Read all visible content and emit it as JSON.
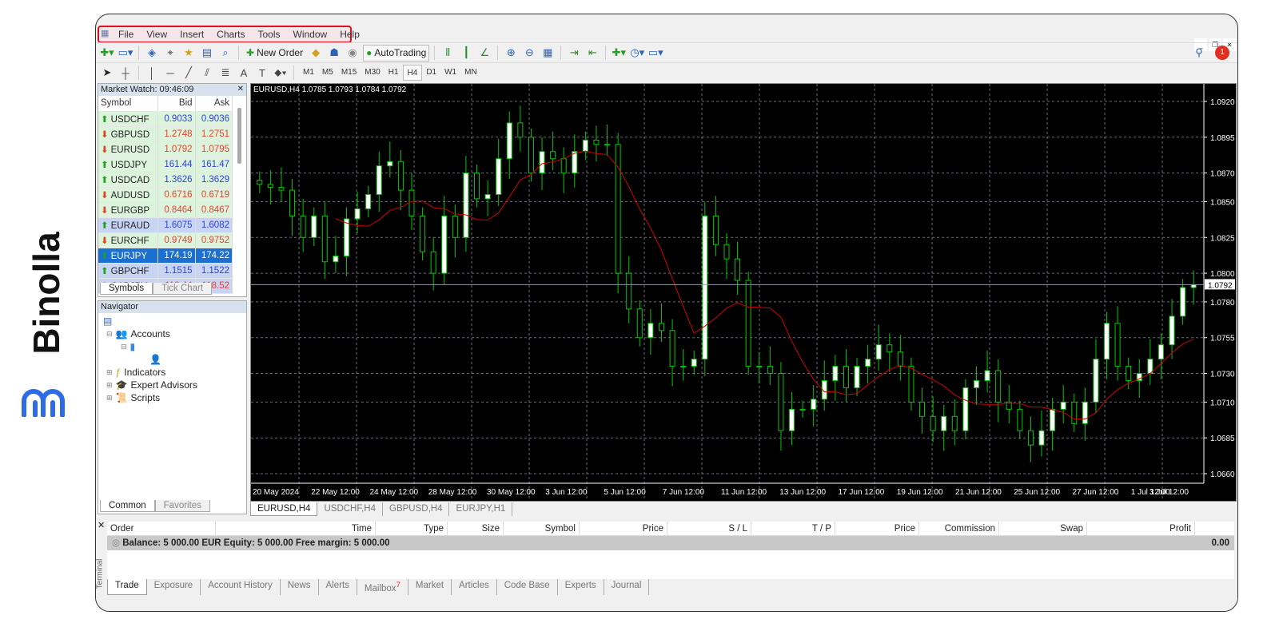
{
  "brand": {
    "name": "Binolla"
  },
  "menu": [
    "File",
    "View",
    "Insert",
    "Charts",
    "Tools",
    "Window",
    "Help"
  ],
  "toolbar": {
    "new_order": "New Order",
    "autotrading": "AutoTrading",
    "notification_count": "1"
  },
  "timeframes": [
    "M1",
    "M5",
    "M15",
    "M30",
    "H1",
    "H4",
    "D1",
    "W1",
    "MN"
  ],
  "active_timeframe": "H4",
  "market_watch": {
    "title": "Market Watch: 09:46:09",
    "columns": [
      "Symbol",
      "Bid",
      "Ask"
    ],
    "rows": [
      {
        "symbol": "USDCHF",
        "bid": "0.9033",
        "ask": "0.9036",
        "dir": "up"
      },
      {
        "symbol": "GBPUSD",
        "bid": "1.2748",
        "ask": "1.2751",
        "dir": "dn"
      },
      {
        "symbol": "EURUSD",
        "bid": "1.0792",
        "ask": "1.0795",
        "dir": "dn"
      },
      {
        "symbol": "USDJPY",
        "bid": "161.44",
        "ask": "161.47",
        "dir": "up"
      },
      {
        "symbol": "USDCAD",
        "bid": "1.3626",
        "ask": "1.3629",
        "dir": "up"
      },
      {
        "symbol": "AUDUSD",
        "bid": "0.6716",
        "ask": "0.6719",
        "dir": "dn"
      },
      {
        "symbol": "EURGBP",
        "bid": "0.8464",
        "ask": "0.8467",
        "dir": "dn"
      },
      {
        "symbol": "EURAUD",
        "bid": "1.6075",
        "ask": "1.6082",
        "dir": "up"
      },
      {
        "symbol": "EURCHF",
        "bid": "0.9749",
        "ask": "0.9752",
        "dir": "dn"
      },
      {
        "symbol": "EURJPY",
        "bid": "174.19",
        "ask": "174.22",
        "dir": "up"
      },
      {
        "symbol": "GBPCHF",
        "bid": "1.1515",
        "ask": "1.1522",
        "dir": "up"
      },
      {
        "symbol": "CADJPY",
        "bid": "118.44",
        "ask": "118.52",
        "dir": "dn"
      }
    ],
    "tabs": [
      "Symbols",
      "Tick Chart"
    ]
  },
  "navigator": {
    "title": "Navigator",
    "items": [
      "Accounts",
      "Indicators",
      "Expert Advisors",
      "Scripts"
    ],
    "tabs": [
      "Common",
      "Favorites"
    ]
  },
  "chart": {
    "header": "EURUSD,H4  1.0785 1.0793 1.0784 1.0792",
    "current_price": "1.0792",
    "tabs": [
      "EURUSD,H4",
      "USDCHF,H4",
      "GBPUSD,H4",
      "EURJPY,H1"
    ]
  },
  "chart_data": {
    "type": "candlestick",
    "symbol": "EURUSD",
    "timeframe": "H4",
    "ylim": [
      1.065,
      1.093
    ],
    "yticks": [
      "1.0920",
      "1.0895",
      "1.0870",
      "1.0850",
      "1.0825",
      "1.0800",
      "1.0780",
      "1.0755",
      "1.0730",
      "1.0710",
      "1.0685",
      "1.0660"
    ],
    "xticks": [
      "20 May 2024",
      "22 May 12:00",
      "24 May 12:00",
      "28 May 12:00",
      "30 May 12:00",
      "3 Jun 12:00",
      "5 Jun 12:00",
      "7 Jun 12:00",
      "11 Jun 12:00",
      "13 Jun 12:00",
      "17 Jun 12:00",
      "19 Jun 12:00",
      "21 Jun 12:00",
      "25 Jun 12:00",
      "27 Jun 12:00",
      "1 Jul 12:00",
      "3 Jul 12:00"
    ],
    "closes": [
      1.0862,
      1.086,
      1.0858,
      1.084,
      1.0825,
      1.084,
      1.0808,
      1.0812,
      1.0838,
      1.0845,
      1.0855,
      1.0875,
      1.0878,
      1.0858,
      1.084,
      1.0815,
      1.08,
      1.084,
      1.0825,
      1.087,
      1.0852,
      1.0855,
      1.088,
      1.0905,
      1.0895,
      1.087,
      1.0885,
      1.088,
      1.087,
      1.0885,
      1.0893,
      1.089,
      1.089,
      1.08,
      1.0775,
      1.0755,
      1.0765,
      1.076,
      1.0735,
      1.0735,
      1.074,
      1.084,
      1.082,
      1.081,
      1.0795,
      1.0735,
      1.0735,
      1.073,
      1.069,
      1.0705,
      1.0705,
      1.0712,
      1.0725,
      1.0735,
      1.072,
      1.0735,
      1.074,
      1.075,
      1.0745,
      1.0735,
      1.071,
      1.07,
      1.069,
      1.07,
      1.069,
      1.072,
      1.0725,
      1.0732,
      1.071,
      1.0705,
      1.069,
      1.068,
      1.069,
      1.0705,
      1.071,
      1.0695,
      1.071,
      1.074,
      1.0765,
      1.0735,
      1.0725,
      1.073,
      1.074,
      1.075,
      1.077,
      1.079,
      1.0792
    ],
    "ma_period": 8,
    "colors": {
      "candle": "#00c800",
      "bull_body": "#ffffff",
      "bear_body": "#000000",
      "ma": "#d00000",
      "grid": "#6a6a7a"
    }
  },
  "terminal": {
    "label": "Terminal",
    "columns": [
      "Order",
      "Time",
      "Type",
      "Size",
      "Symbol",
      "Price",
      "S / L",
      "T / P",
      "Price",
      "Commission",
      "Swap",
      "Profit"
    ],
    "balance": "Balance: 5 000.00 EUR  Equity: 5 000.00  Free margin: 5 000.00",
    "profit": "0.00",
    "tabs": [
      "Trade",
      "Exposure",
      "Account History",
      "News",
      "Alerts",
      "Mailbox",
      "Market",
      "Articles",
      "Code Base",
      "Experts",
      "Journal"
    ],
    "mailbox_count": "7"
  }
}
